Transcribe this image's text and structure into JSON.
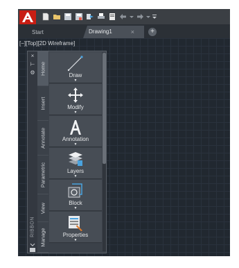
{
  "quick_access": {
    "icons": [
      "new-icon",
      "open-icon",
      "save-icon",
      "save-as-icon",
      "publish-icon",
      "plot-icon",
      "undo-icon",
      "redo-icon",
      "customize-dropdown-icon"
    ]
  },
  "tabs": {
    "start_label": "Start",
    "drawing_label": "Drawing1",
    "close_glyph": "×",
    "add_glyph": "+"
  },
  "viewport": {
    "label": "[−][Top][2D Wireframe]"
  },
  "ribbon": {
    "label": "RIBBON",
    "controls": {
      "close": "×",
      "pin": "⊢",
      "settings": "⚙"
    },
    "tabs": [
      {
        "label": "Home",
        "active": true
      },
      {
        "label": "Insert"
      },
      {
        "label": "Annotate"
      },
      {
        "label": "Parametric"
      },
      {
        "label": "View"
      },
      {
        "label": "Manage"
      }
    ],
    "panels": [
      {
        "label": "Draw",
        "icon": "line-draw-icon"
      },
      {
        "label": "Modify",
        "icon": "move-arrows-icon"
      },
      {
        "label": "Annotation",
        "icon": "text-a-icon"
      },
      {
        "label": "Layers",
        "icon": "layers-icon"
      },
      {
        "label": "Block",
        "icon": "block-icon"
      },
      {
        "label": "Properties",
        "icon": "properties-icon"
      }
    ],
    "panel_arrow": "▼"
  },
  "colors": {
    "viewport_bg": "#212830",
    "titlebar_bg": "#3b3f44",
    "logo_red": "#d9261c",
    "panel_bg": "#474d55"
  }
}
